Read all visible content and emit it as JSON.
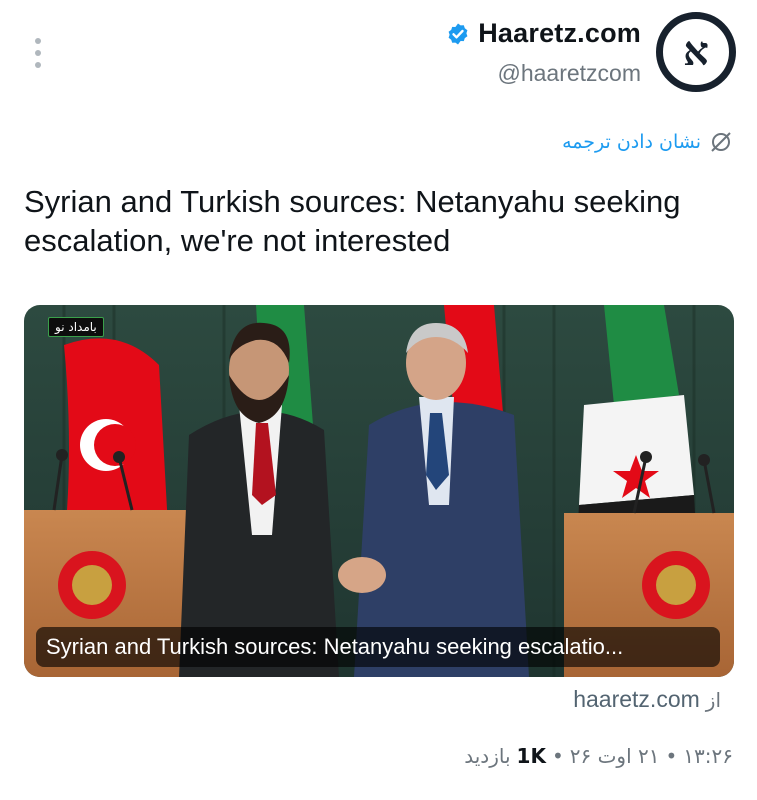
{
  "account": {
    "display_name": "Haaretz.com",
    "handle": "@haaretzcom",
    "avatar_letter": "א",
    "verified": true
  },
  "translate": {
    "label": "نشان دادن ترجمه"
  },
  "tweet": {
    "text": "Syrian and Turkish sources: Netanyahu seeking escalation, we're not interested"
  },
  "card": {
    "caption": "Syrian and Turkish sources: Netanyahu seeking escalatio...",
    "badge": "بامداد نو",
    "source_prefix": "از",
    "source_domain": "haaretz.com"
  },
  "meta": {
    "time": "۱۳:۲۶",
    "date": "۲۱ اوت ۲۶",
    "views_count": "1K",
    "views_label": "بازدید",
    "separator": "•"
  },
  "colors": {
    "accent": "#1d9bf0",
    "text": "#0f1419",
    "muted": "#6c757d",
    "avatar_ring": "#17212d"
  }
}
